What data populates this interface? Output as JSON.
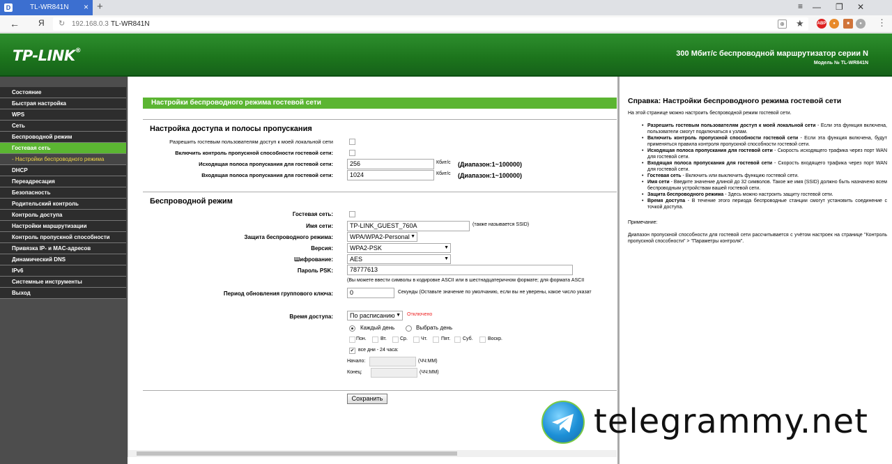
{
  "browser": {
    "tab_title": "TL-WR841N",
    "url": "192.168.0.3",
    "page_title": "TL-WR841N",
    "yandex_label": "Я"
  },
  "header": {
    "logo": "TP-LINK",
    "logo_mark": "®",
    "product_line": "300 Мбит/с беспроводной маршрутизатор серии N",
    "model": "Модель № TL-WR841N"
  },
  "menu": {
    "items": [
      {
        "label": "Состояние"
      },
      {
        "label": "Быстрая настройка"
      },
      {
        "label": "WPS"
      },
      {
        "label": "Сеть"
      },
      {
        "label": "Беспроводной режим"
      },
      {
        "label": "Гостевая сеть"
      },
      {
        "label": "- Настройки беспроводного режима"
      },
      {
        "label": "DHCP"
      },
      {
        "label": "Переадресация"
      },
      {
        "label": "Безопасность"
      },
      {
        "label": "Родительский контроль"
      },
      {
        "label": "Контроль доступа"
      },
      {
        "label": "Настройки маршрутизации"
      },
      {
        "label": "Контроль пропускной способности"
      },
      {
        "label": "Привязка IP- и MAC-адресов"
      },
      {
        "label": "Динамический DNS"
      },
      {
        "label": "IPv6"
      },
      {
        "label": "Системные инструменты"
      },
      {
        "label": "Выход"
      }
    ]
  },
  "main": {
    "title": "Настройки беспроводного режима гостевой сети",
    "access_section": {
      "heading": "Настройка доступа и полосы пропускания",
      "allow_local_label": "Разрешить гостевым пользователям доступ к моей локальной сети",
      "bandwidth_control_label": "Включить контроль пропускной способности гостевой сети:",
      "egress_label": "Исходящая полоса пропускания для гостевой сети:",
      "egress_value": "256",
      "ingress_label": "Входящая полоса пропускания для гостевой сети:",
      "ingress_value": "1024",
      "unit": "Кбит/с",
      "range": "(Диапазон:1~100000)"
    },
    "wireless_section": {
      "heading": "Беспроводной режим",
      "guest_network_label": "Гостевая сеть:",
      "ssid_label": "Имя сети:",
      "ssid_value": "TP-LINK_GUEST_760A",
      "ssid_hint": "(также называется SSID)",
      "security_label": "Защита беспроводного режима:",
      "security_value": "WPA/WPA2-Personal",
      "version_label": "Версия:",
      "version_value": "WPA2-PSK",
      "encryption_label": "Шифрование:",
      "encryption_value": "AES",
      "psk_label": "Пароль PSK:",
      "psk_value": "78777613",
      "psk_hint": "(Вы можете ввести символы в кодировке ASCII или в шестнадцатеричном формате; для формата ASCII",
      "group_key_label": "Период обновления группового ключа:",
      "group_key_value": "0",
      "group_key_hint": "Секунды (Оставьте значение по умолчанию, если вы не уверены, какое число указат"
    },
    "schedule": {
      "access_time_label": "Время доступа:",
      "access_time_value": "По расписанию",
      "status": "Отключено",
      "every_day": "Каждый день",
      "select_days": "Выбрать день",
      "days": [
        "Пон.",
        "Вт.",
        "Ср.",
        "Чт.",
        "Пят.",
        "Суб.",
        "Воскр."
      ],
      "all_day": "все дни - 24 часа:",
      "start_label": "Начало:",
      "end_label": "Конец:",
      "time_format": "(ЧЧ:ММ)"
    },
    "save_button": "Сохранить"
  },
  "help": {
    "title": "Справка: Настройки беспроводного режима гостевой сети",
    "intro": "На этой странице можно настроить беспроводной режим гостевой сети.",
    "items": [
      {
        "term": "Разрешить гостевым пользователям доступ к моей локальной сети",
        "desc": " - Если эта функция включена, пользователи смогут подключаться к узлам."
      },
      {
        "term": "Включить контроль пропускной способности гостевой сети",
        "desc": " - Если эта функция включена, будут применяться правила контроля пропускной способности гостевой сети."
      },
      {
        "term": "Исходящая полоса пропускания для гостевой сети",
        "desc": " - Скорость исходящего трафика через порт WAN для гостевой сети."
      },
      {
        "term": "Входящая полоса пропускания для гостевой сети",
        "desc": " - Скорость входящего трафика через порт WAN для гостевой сети."
      },
      {
        "term": "Гостевая сеть",
        "desc": " - Включить или выключить функцию гостевой сети."
      },
      {
        "term": "Имя сети",
        "desc": " - Введите значение длиной до 32 символов. Такое же имя (SSID) должно быть назначено всем беспроводным устройствам вашей гостевой сети."
      },
      {
        "term": "Защита беспроводного режима",
        "desc": " - Здесь можно настроить защиту гостевой сети."
      },
      {
        "term": "Время доступа",
        "desc": " - В течение этого периода беспроводные станции смогут установить соединение с точкой доступа."
      }
    ],
    "note_title": "Примечание:",
    "note_text": "Диапазон пропускной способности для гостевой сети рассчитывается с учётом настроек на странице \"Контроль пропускной способности\" > \"Параметры контроля\"."
  },
  "watermark": {
    "text": "telegrammy.net"
  }
}
